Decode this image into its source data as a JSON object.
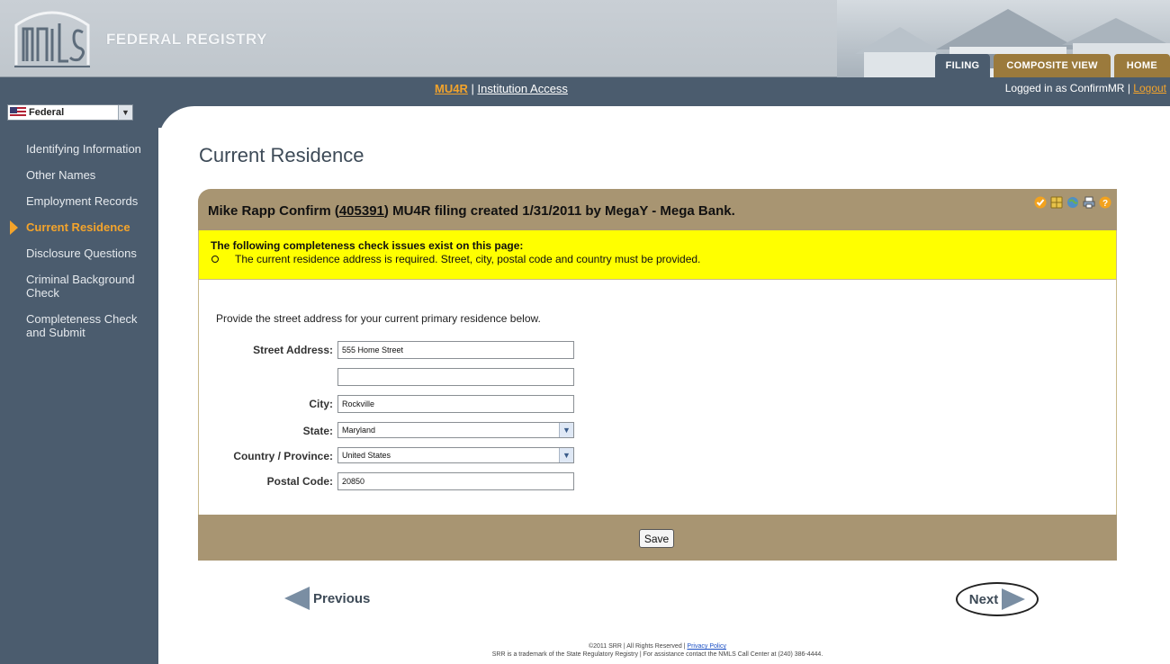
{
  "header": {
    "brand_title": "FEDERAL REGISTRY",
    "tabs": [
      {
        "label": "FILING"
      },
      {
        "label": "COMPOSITE VIEW"
      },
      {
        "label": "HOME"
      }
    ]
  },
  "subbar": {
    "mu4r_link": "MU4R",
    "separator": "|",
    "institution_link": "Institution Access",
    "logged_in_text": "Logged in as ConfirmMR",
    "logout_link": "Logout"
  },
  "sidebar": {
    "jurisdiction": "Federal",
    "items": [
      {
        "label": "Identifying Information"
      },
      {
        "label": "Other Names"
      },
      {
        "label": "Employment Records"
      },
      {
        "label": "Current Residence"
      },
      {
        "label": "Disclosure Questions"
      },
      {
        "label": "Criminal Background Check"
      },
      {
        "label": "Completeness Check and Submit"
      }
    ]
  },
  "main": {
    "page_title": "Current Residence",
    "panel": {
      "title_prefix": "Mike Rapp Confirm (",
      "title_id": "405391",
      "title_suffix": ") MU4R filing created 1/31/2011 by MegaY - Mega Bank."
    },
    "warning": {
      "title": "The following completeness check issues exist on this page:",
      "issue": "The current residence address is required. Street, city, postal code and country must be provided."
    },
    "form": {
      "intro": "Provide the street address for your current primary residence below.",
      "street_label": "Street Address:",
      "street_value": "555 Home Street",
      "street2_value": "",
      "city_label": "City:",
      "city_value": "Rockville",
      "state_label": "State:",
      "state_value": "Maryland",
      "country_label": "Country / Province:",
      "country_value": "United States",
      "postal_label": "Postal Code:",
      "postal_value": "20850"
    },
    "save_label": "Save",
    "prev_label": "Previous",
    "next_label": "Next"
  },
  "footer": {
    "line1_prefix": "©2011 SRR | All Rights Reserved | ",
    "privacy_link": "Privacy Policy",
    "line2": "SRR is a trademark of the State Regulatory Registry | For assistance contact the NMLS Call Center at (240) 386-4444."
  },
  "colors": {
    "nav_bg": "#4b5c6e",
    "accent_orange": "#f4a42b",
    "panel_tan": "#a89572",
    "warning_yellow": "#ffff00"
  }
}
